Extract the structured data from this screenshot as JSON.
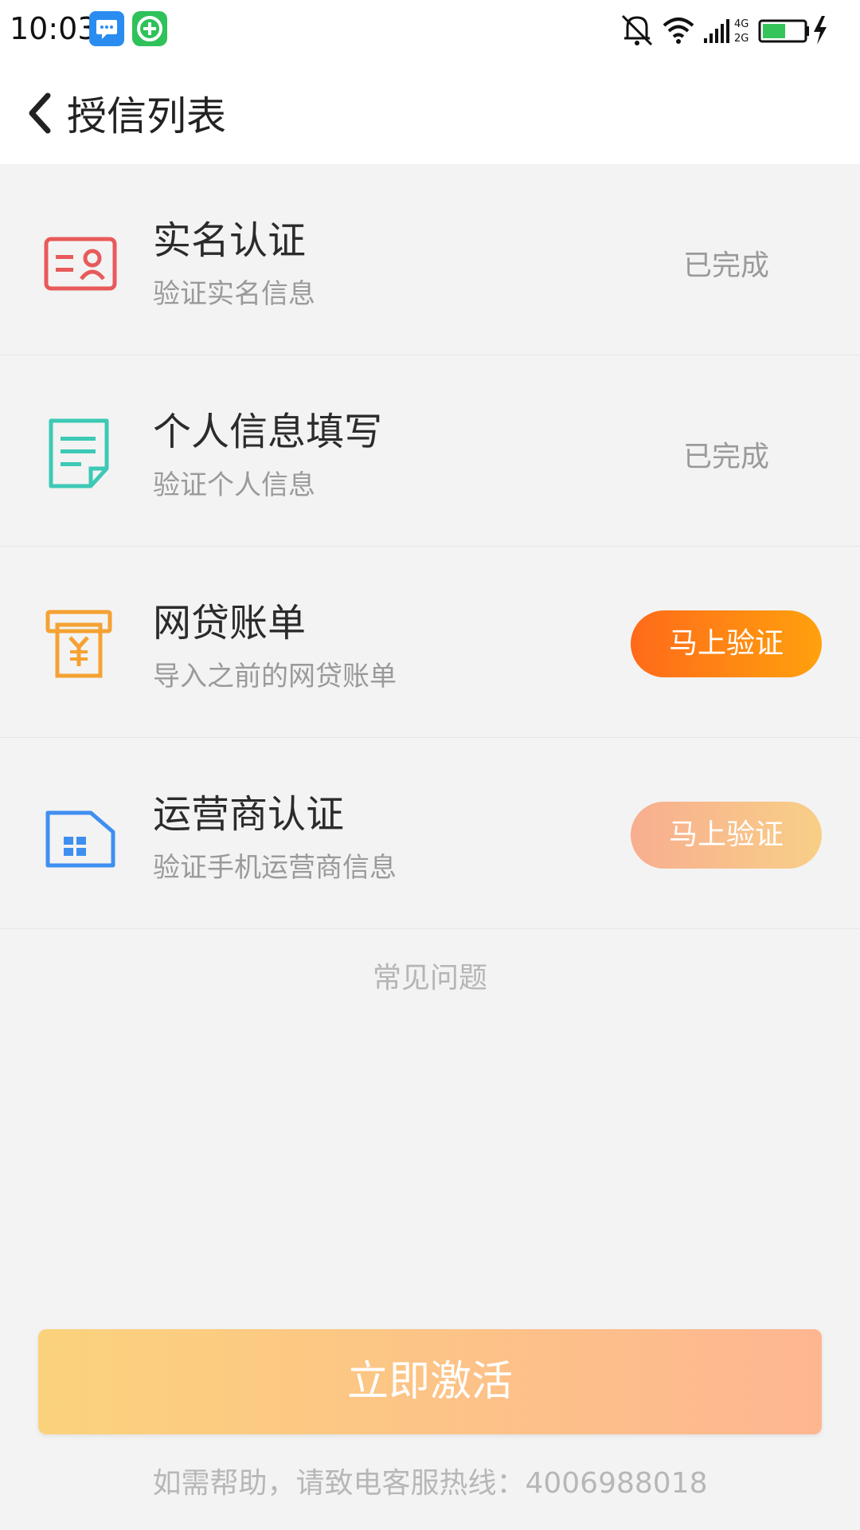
{
  "status_bar": {
    "time": "10:03",
    "network": "4G\n2G",
    "icons": [
      "message-icon",
      "plus-icon",
      "bell-off-icon",
      "wifi-icon",
      "signal-icon",
      "battery-icon",
      "charging-icon"
    ]
  },
  "header": {
    "title": "授信列表",
    "back_icon": "chevron-left-icon"
  },
  "items": [
    {
      "title": "实名认证",
      "subtitle": "验证实名信息",
      "status": "已完成",
      "icon": "id-card-icon",
      "icon_color": "#e85a5a"
    },
    {
      "title": "个人信息填写",
      "subtitle": "验证个人信息",
      "status": "已完成",
      "icon": "document-icon",
      "icon_color": "#3cc9b6"
    },
    {
      "title": "网贷账单",
      "subtitle": "导入之前的网贷账单",
      "action": "马上验证",
      "icon": "bill-yen-icon",
      "icon_color": "#f5a233"
    },
    {
      "title": "运营商认证",
      "subtitle": "验证手机运营商信息",
      "action": "马上验证",
      "icon": "sim-card-icon",
      "icon_color": "#3f8ff0"
    }
  ],
  "faq": "常见问题",
  "activate_button": "立即激活",
  "hotline": "如需帮助，请致电客服热线：4006988018",
  "colors": {
    "accent_orange": "#ff6a1a",
    "accent_yellow": "#ffa10d",
    "background": "#f3f3f3"
  }
}
